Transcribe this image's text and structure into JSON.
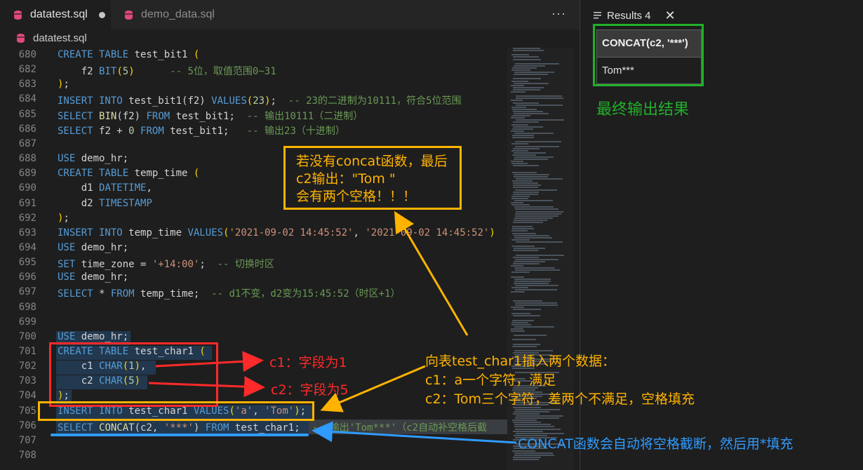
{
  "tabs": [
    {
      "label": "datatest.sql",
      "modified": true
    },
    {
      "label": "demo_data.sql"
    }
  ],
  "more_label": "···",
  "breadcrumb": "datatest.sql",
  "code": [
    {
      "n": "680",
      "t": [
        [
          "kw",
          "CREATE TABLE "
        ],
        [
          "",
          "test_bit1 "
        ],
        [
          "par",
          "("
        ]
      ]
    },
    {
      "n": "682",
      "t": [
        [
          "",
          "    f2 "
        ],
        [
          "kw",
          "BIT"
        ],
        [
          "par",
          "("
        ],
        [
          "num",
          "5"
        ],
        [
          "par",
          ")"
        ],
        [
          "",
          "      "
        ],
        [
          "cm",
          "-- 5位，取值范围0~31"
        ]
      ]
    },
    {
      "n": "683",
      "t": [
        [
          "par",
          ")"
        ],
        [
          "",
          ";"
        ]
      ]
    },
    {
      "n": "684",
      "t": [
        [
          "kw",
          "INSERT INTO "
        ],
        [
          "",
          "test_bit1(f2) "
        ],
        [
          "kw",
          "VALUES"
        ],
        [
          "par",
          "("
        ],
        [
          "num",
          "23"
        ],
        [
          "par",
          ")"
        ],
        [
          "",
          ";  "
        ],
        [
          "cm",
          "-- 23的二进制为10111，符合5位范围"
        ]
      ]
    },
    {
      "n": "685",
      "t": [
        [
          "kw",
          "SELECT "
        ],
        [
          "fn",
          "BIN"
        ],
        [
          "",
          "(f2) "
        ],
        [
          "kw",
          "FROM "
        ],
        [
          "",
          "test_bit1;  "
        ],
        [
          "cm",
          "-- 输出10111（二进制）"
        ]
      ]
    },
    {
      "n": "686",
      "t": [
        [
          "kw",
          "SELECT "
        ],
        [
          "",
          "f2 + "
        ],
        [
          "num",
          "0 "
        ],
        [
          "kw",
          "FROM "
        ],
        [
          "",
          "test_bit1;   "
        ],
        [
          "cm",
          "-- 输出23（十进制）"
        ]
      ]
    },
    {
      "n": "687",
      "t": []
    },
    {
      "n": "688",
      "t": [
        [
          "kw",
          "USE "
        ],
        [
          "",
          "demo_hr;"
        ]
      ]
    },
    {
      "n": "689",
      "t": [
        [
          "kw",
          "CREATE TABLE "
        ],
        [
          "",
          "temp_time "
        ],
        [
          "par",
          "("
        ]
      ]
    },
    {
      "n": "690",
      "t": [
        [
          "",
          "    d1 "
        ],
        [
          "kw",
          "DATETIME"
        ],
        [
          "",
          ","
        ]
      ]
    },
    {
      "n": "691",
      "t": [
        [
          "",
          "    d2 "
        ],
        [
          "kw",
          "TIMESTAMP"
        ]
      ]
    },
    {
      "n": "692",
      "t": [
        [
          "par",
          ")"
        ],
        [
          "",
          ";"
        ]
      ]
    },
    {
      "n": "693",
      "t": [
        [
          "kw",
          "INSERT INTO "
        ],
        [
          "",
          "temp_time "
        ],
        [
          "kw",
          "VALUES"
        ],
        [
          "par",
          "("
        ],
        [
          "str",
          "'2021-09-02 14:45:52'"
        ],
        [
          "",
          ", "
        ],
        [
          "str",
          "'2021-09-02 14:45:52'"
        ],
        [
          "par",
          ")"
        ]
      ]
    },
    {
      "n": "694",
      "t": [
        [
          "kw",
          "USE "
        ],
        [
          "",
          "demo_hr;"
        ]
      ]
    },
    {
      "n": "695",
      "t": [
        [
          "kw",
          "SET "
        ],
        [
          "",
          "time_zone = "
        ],
        [
          "str",
          "'+14:00'"
        ],
        [
          "",
          ";  "
        ],
        [
          "cm",
          "-- 切换时区"
        ]
      ]
    },
    {
      "n": "696",
      "t": [
        [
          "kw",
          "USE "
        ],
        [
          "",
          "demo_hr;"
        ]
      ]
    },
    {
      "n": "697",
      "t": [
        [
          "kw",
          "SELECT "
        ],
        [
          "",
          "* "
        ],
        [
          "kw",
          "FROM "
        ],
        [
          "",
          "temp_time;  "
        ],
        [
          "cm",
          "-- d1不变，d2变为15:45:52（时区+1）"
        ]
      ]
    },
    {
      "n": "698",
      "t": []
    },
    {
      "n": "699",
      "t": []
    },
    {
      "n": "700",
      "t": [
        [
          "kw",
          "USE "
        ],
        [
          "",
          "demo_hr;"
        ]
      ]
    },
    {
      "n": "701",
      "t": [
        [
          "kw",
          "CREATE TABLE "
        ],
        [
          "",
          "test_char1 "
        ],
        [
          "par",
          "("
        ]
      ]
    },
    {
      "n": "702",
      "t": [
        [
          "",
          "    c1 "
        ],
        [
          "kw",
          "CHAR"
        ],
        [
          "par",
          "("
        ],
        [
          "num",
          "1"
        ],
        [
          "par",
          ")"
        ],
        [
          "",
          ","
        ]
      ]
    },
    {
      "n": "703",
      "t": [
        [
          "",
          "    c2 "
        ],
        [
          "kw",
          "CHAR"
        ],
        [
          "par",
          "("
        ],
        [
          "num",
          "5"
        ],
        [
          "par",
          ")"
        ]
      ]
    },
    {
      "n": "704",
      "t": [
        [
          "par",
          ")"
        ],
        [
          "",
          ";"
        ]
      ]
    },
    {
      "n": "705",
      "t": [
        [
          "kw",
          "INSERT INTO "
        ],
        [
          "",
          "test_char1 "
        ],
        [
          "kw",
          "VALUES"
        ],
        [
          "par",
          "("
        ],
        [
          "str",
          "'a'"
        ],
        [
          "",
          ", "
        ],
        [
          "str",
          "'Tom'"
        ],
        [
          "par",
          ")"
        ],
        [
          "",
          ";"
        ]
      ]
    },
    {
      "n": "706",
      "t": [
        [
          "kw",
          "SELECT "
        ],
        [
          "fn",
          "CONCAT"
        ],
        [
          "",
          "(c2, "
        ],
        [
          "str",
          "'***'"
        ],
        [
          "",
          ") "
        ],
        [
          "kw",
          "FROM "
        ],
        [
          "",
          "test_char1;  "
        ],
        [
          "cm",
          "-- 输出'Tom***'（c2自动补空格后截"
        ]
      ]
    },
    {
      "n": "707",
      "t": []
    },
    {
      "n": "708",
      "t": []
    }
  ],
  "results": {
    "title": "Results 4",
    "header": "CONCAT(c2, '***')",
    "cell": "Tom***"
  },
  "annotations": {
    "final": "最终输出结果",
    "no_concat_1": "若没有concat函数，最后",
    "no_concat_2": "c2输出：\"Tom  \"",
    "no_concat_3": "会有两个空格！！！",
    "c1": "c1：字段为1",
    "c2": "c2：字段为5",
    "insert_1": "向表test_char1插入两个数据：",
    "insert_2": "c1：a一个字符，满足",
    "insert_3": "c2：Tom三个字符，差两个不满足，空格填充",
    "concat": "CONCAT函数会自动将空格截断，然后用*填充"
  },
  "colors": {
    "red": "#ff2a2a",
    "orange": "#ffb300",
    "green": "#22b02a",
    "blue": "#2f9bff"
  }
}
